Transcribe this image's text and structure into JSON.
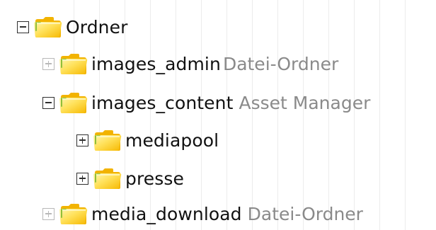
{
  "tree": {
    "root": {
      "name": "Ordner",
      "expanded": true,
      "icon": "folder-icon"
    },
    "items": [
      {
        "name": "images_admin",
        "description": "Datei-Ordner",
        "toggle": "plus",
        "toggle_state": "disabled",
        "icon": "folder-icon"
      },
      {
        "name": "images_content",
        "description": "Asset Manager",
        "toggle": "minus",
        "toggle_state": "enabled",
        "icon": "folder-icon"
      },
      {
        "name": "mediapool",
        "description": "",
        "toggle": "plus",
        "toggle_state": "enabled",
        "icon": "folder-icon"
      },
      {
        "name": "presse",
        "description": "",
        "toggle": "plus",
        "toggle_state": "enabled",
        "icon": "folder-icon"
      },
      {
        "name": "media_download",
        "description": "Datei-Ordner",
        "toggle": "plus",
        "toggle_state": "disabled",
        "icon": "folder-icon"
      }
    ]
  },
  "colors": {
    "name_text": "#111111",
    "description_text": "#8a8a8a",
    "folder_yellow": "#ffd43a",
    "folder_light": "#fff3a8",
    "grid_line": "#ececec"
  }
}
